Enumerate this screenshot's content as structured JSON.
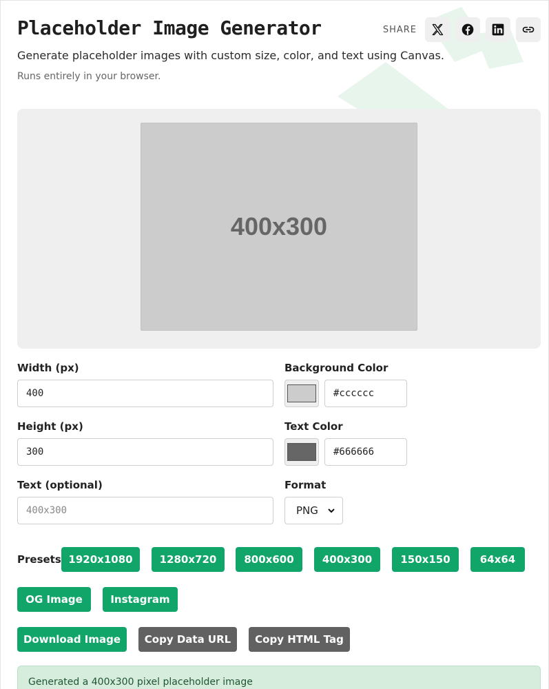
{
  "header": {
    "title": "Placeholder Image Generator",
    "subtitle": "Generate placeholder images with custom size, color, and text using Canvas.",
    "note": "Runs entirely in your browser."
  },
  "share": {
    "label": "SHARE",
    "buttons": [
      {
        "icon": "x-twitter-icon"
      },
      {
        "icon": "facebook-icon"
      },
      {
        "icon": "linkedin-icon"
      },
      {
        "icon": "link-icon"
      }
    ]
  },
  "preview": {
    "text": "400x300",
    "background_color": "#cccccc",
    "text_color": "#666666"
  },
  "form": {
    "width": {
      "label": "Width (px)",
      "value": "400"
    },
    "height": {
      "label": "Height (px)",
      "value": "300"
    },
    "text": {
      "label": "Text (optional)",
      "placeholder": "400x300"
    },
    "background": {
      "label": "Background Color",
      "value": "#cccccc"
    },
    "text_color": {
      "label": "Text Color",
      "value": "#666666"
    },
    "format": {
      "label": "Format",
      "value": "PNG"
    }
  },
  "presets": {
    "label": "Presets:",
    "items": [
      "1920x1080",
      "1280x720",
      "800x600",
      "400x300",
      "150x150",
      "64x64",
      "OG Image",
      "Instagram"
    ]
  },
  "actions": {
    "download": "Download Image",
    "copy_data_url": "Copy Data URL",
    "copy_html": "Copy HTML Tag"
  },
  "status": {
    "message": "Generated a 400x300 pixel placeholder image"
  },
  "colors": {
    "accent": "#12a56a",
    "secondary": "#616161",
    "status_bg": "#d6ecdc"
  }
}
